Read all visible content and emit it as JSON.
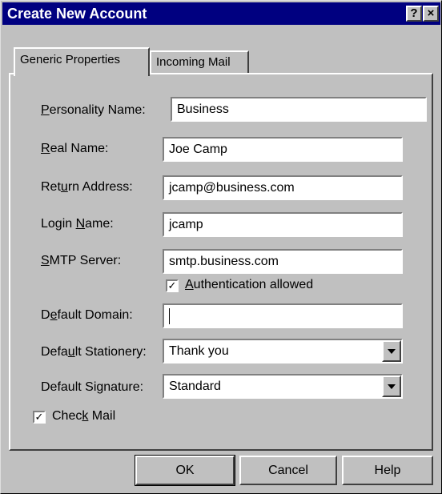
{
  "window": {
    "title": "Create New Account",
    "help_glyph": "?",
    "close_glyph": "×"
  },
  "tabs": [
    {
      "label": "Generic Properties",
      "active": true
    },
    {
      "label": "Incoming Mail",
      "active": false
    }
  ],
  "form": {
    "personality_name": {
      "label_pre": "",
      "label_u": "P",
      "label_post": "ersonality Name:",
      "value": "Business"
    },
    "real_name": {
      "label_pre": "",
      "label_u": "R",
      "label_post": "eal Name:",
      "value": "Joe Camp"
    },
    "return_address": {
      "label_pre": "Ret",
      "label_u": "u",
      "label_post": "rn Address:",
      "value": "jcamp@business.com"
    },
    "login_name": {
      "label_pre": "Login ",
      "label_u": "N",
      "label_post": "ame:",
      "value": "jcamp"
    },
    "smtp_server": {
      "label_pre": "",
      "label_u": "S",
      "label_post": "MTP Server:",
      "value": "smtp.business.com"
    },
    "authentication": {
      "label_pre": "",
      "label_u": "A",
      "label_post": "uthentication allowed",
      "checked": true
    },
    "default_domain": {
      "label_pre": "D",
      "label_u": "e",
      "label_post": "fault Domain:",
      "value": ""
    },
    "default_stationery": {
      "label_pre": "Defa",
      "label_u": "u",
      "label_post": "lt Stationery:",
      "value": "Thank you"
    },
    "default_signature": {
      "label_pre": "Default Si",
      "label_u": "g",
      "label_post": "nature:",
      "value": "Standard"
    },
    "check_mail": {
      "label_pre": "Chec",
      "label_u": "k",
      "label_post": " Mail",
      "checked": true
    }
  },
  "check_glyph": "✓",
  "buttons": {
    "ok": "OK",
    "cancel": "Cancel",
    "help": "Help"
  }
}
